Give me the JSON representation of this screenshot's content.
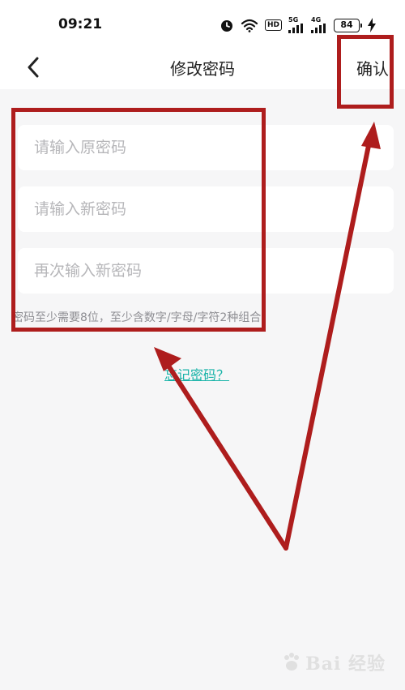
{
  "status_bar": {
    "time": "09:21",
    "hd_label": "HD",
    "net_5g": "5G",
    "net_4g": "4G",
    "battery": "84",
    "icons": [
      "alarm-icon",
      "wifi-icon",
      "signal-icon",
      "charging-icon"
    ]
  },
  "nav": {
    "back_icon": "chevron-left-icon",
    "title": "修改密码",
    "confirm_label": "确认"
  },
  "form": {
    "old_password_placeholder": "请输入原密码",
    "new_password_placeholder": "请输入新密码",
    "repeat_password_placeholder": "再次输入新密码",
    "hint": "密码至少需要8位，至少含数字/字母/字符2种组合",
    "forgot_label": "忘记密码？"
  },
  "colors": {
    "accent": "#17b3a8",
    "annotation": "#ae1d1d",
    "background": "#f6f6f7"
  },
  "watermark": {
    "text": "Bai 经验"
  }
}
